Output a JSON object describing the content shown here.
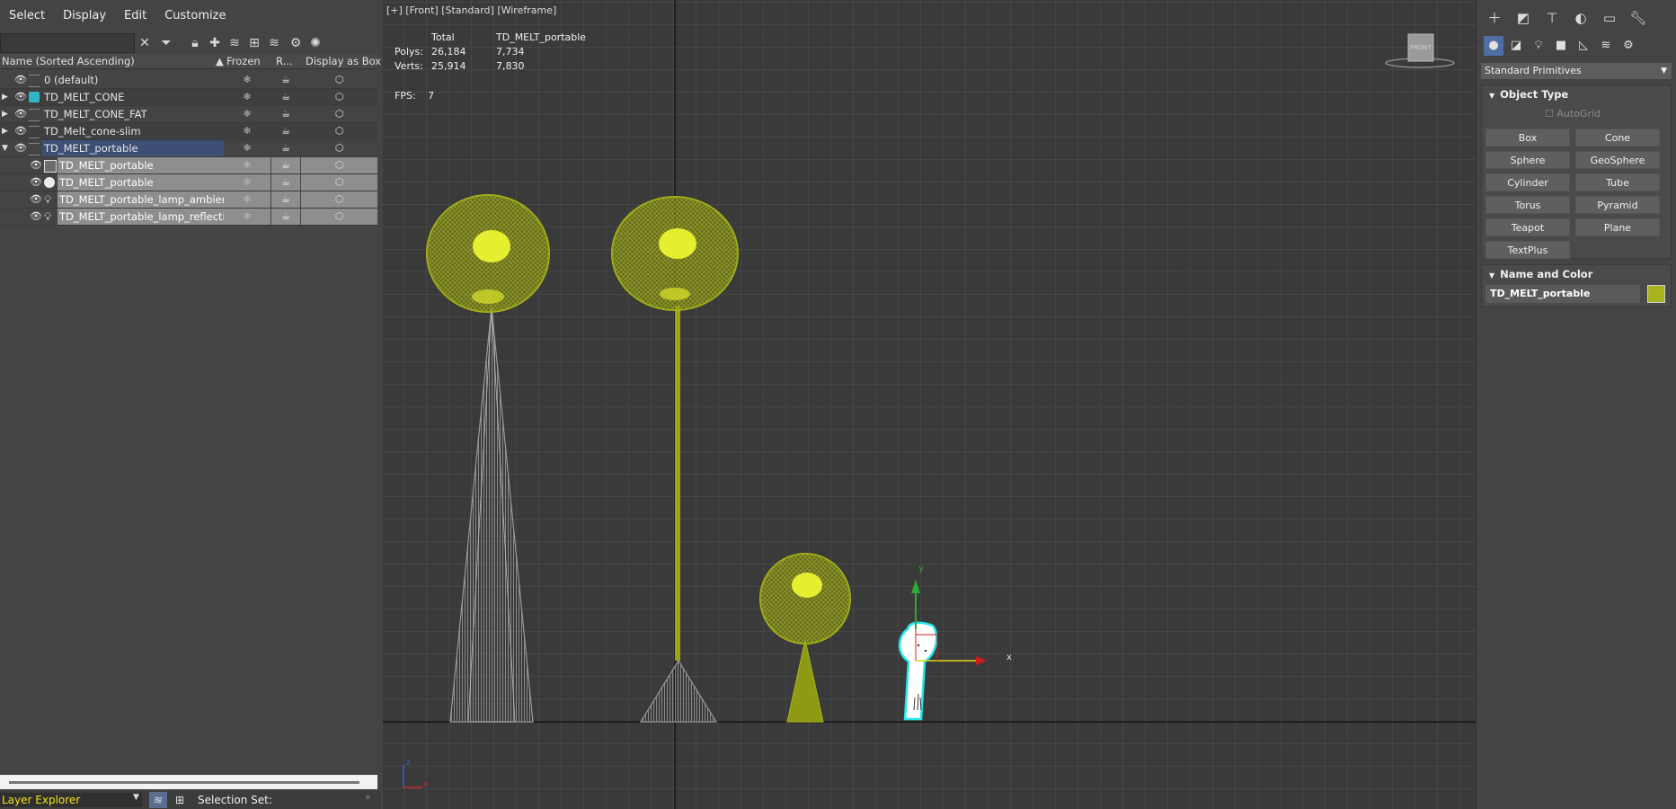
{
  "menubar": {
    "items": [
      "Select",
      "Display",
      "Edit",
      "Customize"
    ]
  },
  "scene_explorer": {
    "columns": {
      "name": "Name (Sorted Ascending)",
      "frozen": "Frozen",
      "render": "R...",
      "display_as_box": "Display as Box"
    },
    "rows": [
      {
        "name": "0 (default)",
        "level": 0,
        "expand": "",
        "selected": false
      },
      {
        "name": "TD_MELT_CONE",
        "level": 0,
        "expand": "▶",
        "selected": false
      },
      {
        "name": "TD_MELT_CONE_FAT",
        "level": 0,
        "expand": "▶",
        "selected": false
      },
      {
        "name": "TD_Melt_cone-slim",
        "level": 0,
        "expand": "▶",
        "selected": false
      },
      {
        "name": "TD_MELT_portable",
        "level": 0,
        "expand": "▼",
        "selected": true
      },
      {
        "name": "TD_MELT_portable",
        "level": 1,
        "icon": "group-icon"
      },
      {
        "name": "TD_MELT_portable",
        "level": 1,
        "icon": "geometry-icon"
      },
      {
        "name": "TD_MELT_portable_lamp_ambient",
        "level": 1,
        "icon": "light-icon"
      },
      {
        "name": "TD_MELT_portable_lamp_reflection",
        "level": 1,
        "icon": "light-icon"
      }
    ],
    "explorer_name": "Layer Explorer",
    "selection_set_label": "Selection Set:"
  },
  "viewport": {
    "label": "[+] [Front] [Standard] [Wireframe]",
    "stats": {
      "total_label": "Total",
      "object_label": "TD_MELT_portable",
      "polys_label": "Polys:",
      "polys_total": "26,184",
      "polys_obj": "7,734",
      "verts_label": "Verts:",
      "verts_total": "25,914",
      "verts_obj": "7,830"
    },
    "fps_label": "FPS:",
    "fps_value": "7",
    "viewcube_label": "FRONT",
    "gizmo_y": "y",
    "gizmo_x": "x",
    "axis_z": "z",
    "axis_x": "x",
    "colors": {
      "background": "#3a3a3a",
      "grid": "#555555",
      "wire_yellow": "#a9b61a",
      "wire_gray": "#8a8a8a",
      "selected": "#22e6ee"
    }
  },
  "command_panel": {
    "tabs": [
      "create-tab-icon",
      "modify-tab-icon",
      "hierarchy-tab-icon",
      "motion-tab-icon",
      "display-tab-icon",
      "utilities-tab-icon"
    ],
    "category": "Standard Primitives",
    "object_type_title": "Object Type",
    "autogrid_label": "AutoGrid",
    "buttons": [
      "Box",
      "Cone",
      "Sphere",
      "GeoSphere",
      "Cylinder",
      "Tube",
      "Torus",
      "Pyramid",
      "Teapot",
      "Plane",
      "TextPlus"
    ],
    "name_color_title": "Name and Color",
    "object_name": "TD_MELT_portable",
    "object_color": "#a7b41d"
  }
}
